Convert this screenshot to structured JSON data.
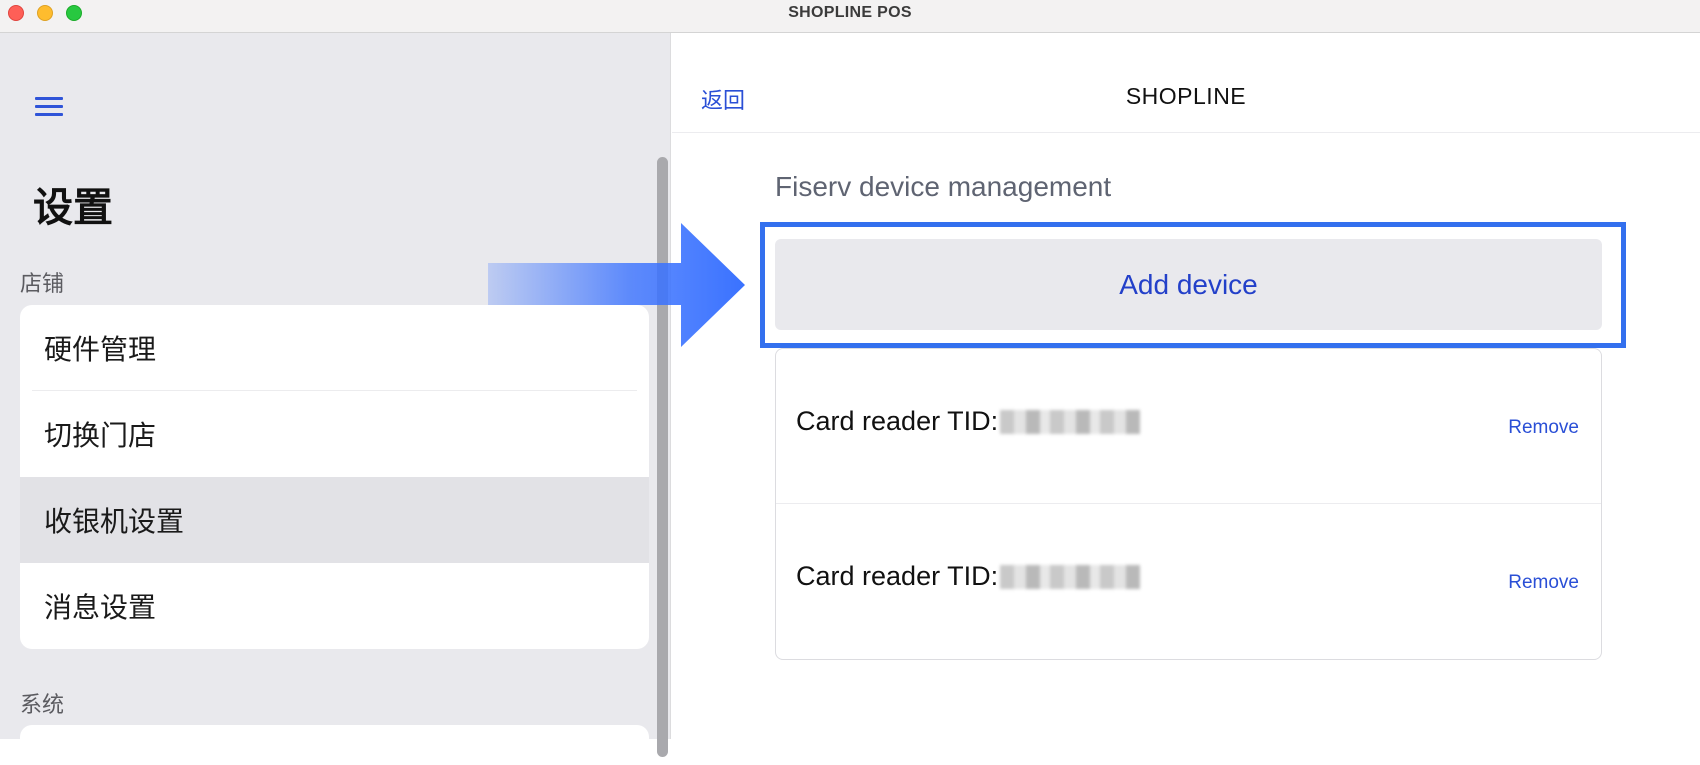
{
  "window": {
    "title": "SHOPLINE POS"
  },
  "sidebar": {
    "title": "设置",
    "sections": [
      {
        "label": "店铺",
        "items": [
          {
            "label": "硬件管理"
          },
          {
            "label": "切换门店"
          },
          {
            "label": "收银机设置",
            "selected": true
          },
          {
            "label": "消息设置"
          }
        ]
      },
      {
        "label": "系统"
      }
    ]
  },
  "main": {
    "back_label": "返回",
    "title": "SHOPLINE",
    "section_heading": "Fiserv device management",
    "add_device_label": "Add device",
    "devices": [
      {
        "label": "Card reader TID:",
        "remove_label": "Remove"
      },
      {
        "label": "Card reader TID:",
        "remove_label": "Remove"
      }
    ]
  },
  "colors": {
    "accent": "#2a4fd6",
    "highlight_border": "#3370ee",
    "arrow": "#3a72ff"
  }
}
